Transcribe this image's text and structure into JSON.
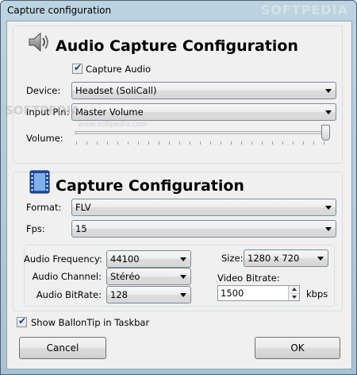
{
  "window": {
    "title": "Capture configuration",
    "watermark": "SOFTPEDIA"
  },
  "audio": {
    "heading": "Audio Capture Configuration",
    "capture_audio_label": "Capture Audio",
    "capture_audio_checked": true,
    "device_label": "Device:",
    "device_value": "Headset (SoliCall)",
    "input_pin_label": "Input Pin:",
    "input_pin_value": "Master Volume",
    "volume_label": "Volume:",
    "volume_level": 1.0,
    "watermark_small": "www.softpedia.com",
    "watermark_large": "SOFTPEDIA"
  },
  "capture": {
    "heading": "Capture Configuration",
    "format_label": "Format:",
    "format_value": "FLV",
    "fps_label": "Fps:",
    "fps_value": "15",
    "audio_frequency_label": "Audio Frequency:",
    "audio_frequency_value": "44100",
    "audio_channel_label": "Audio Channel:",
    "audio_channel_value": "Stéréo",
    "audio_bitrate_label": "Audio BitRate:",
    "audio_bitrate_value": "128",
    "size_label": "Size:",
    "size_value": "1280 x 720",
    "video_bitrate_label": "Video Bitrate:",
    "video_bitrate_value": "1500",
    "video_bitrate_unit": "kbps"
  },
  "balloon_tip": {
    "label": "Show BallonTip in Taskbar",
    "checked": true
  },
  "buttons": {
    "cancel": "Cancel",
    "ok": "OK"
  },
  "icons": {
    "audio": "speaker-icon",
    "capture": "film-icon"
  }
}
